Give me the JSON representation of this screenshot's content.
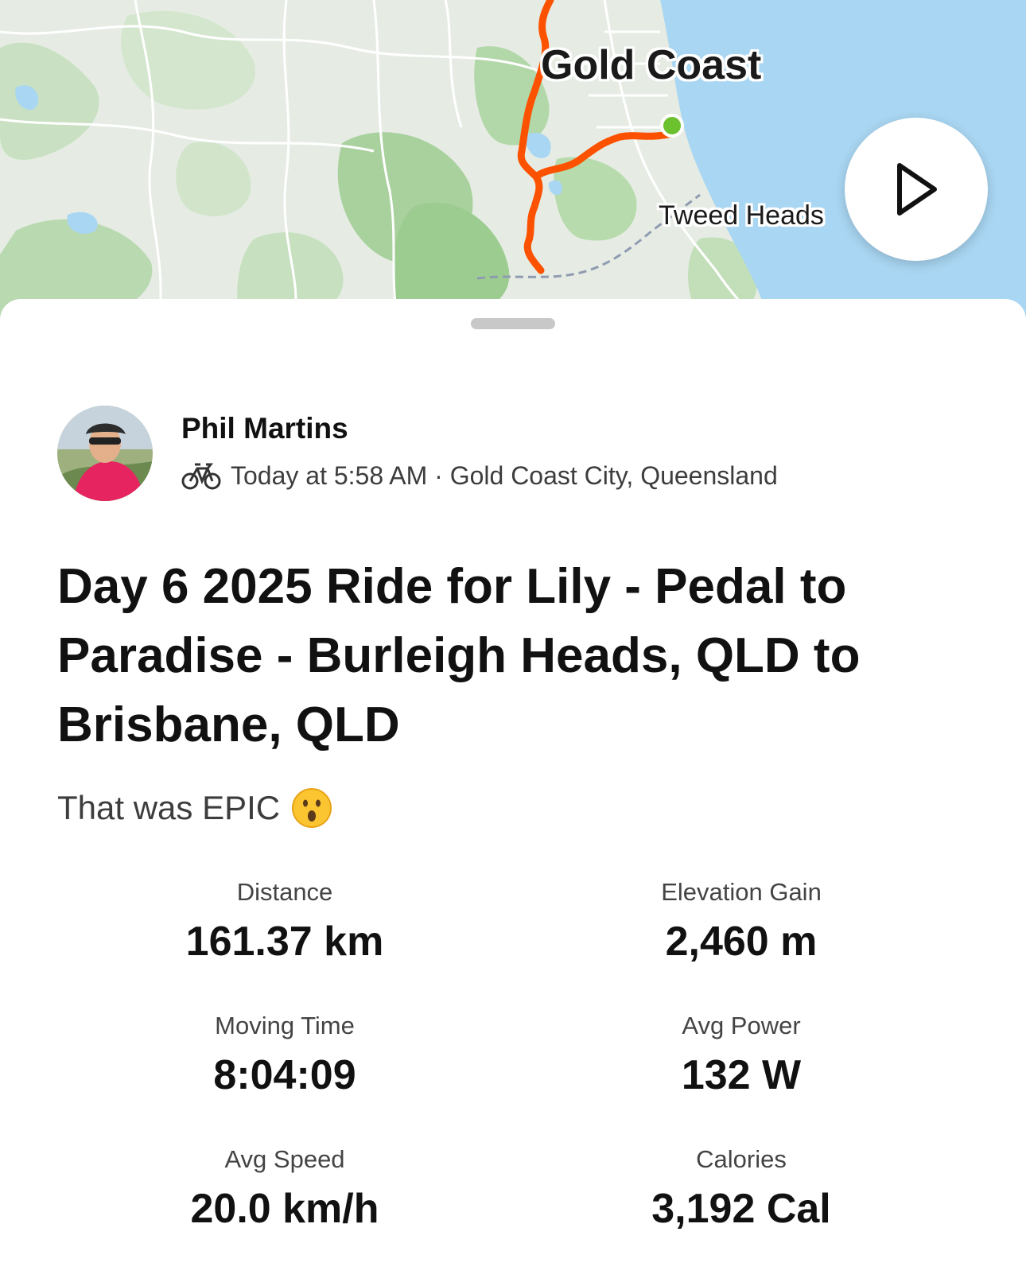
{
  "map": {
    "city_major": "Gold Coast",
    "city_minor": "Tweed Heads",
    "route_color": "#fc5200",
    "start_marker_color": "#6cc12e",
    "water_color": "#a9d6f2"
  },
  "map_controls": {
    "play_icon": "play-icon"
  },
  "athlete": {
    "name": "Phil Martins",
    "activity_icon": "bike-icon",
    "meta": "Today at 5:58 AM · Gold Coast City, Queensland"
  },
  "activity": {
    "title": "Day 6 2025 Ride for Lily - Pedal to Paradise - Burleigh Heads, QLD to Brisbane, QLD",
    "description": "That was EPIC",
    "description_emoji": "😮"
  },
  "stats": [
    {
      "label": "Distance",
      "value": "161.37 km"
    },
    {
      "label": "Elevation Gain",
      "value": "2,460 m"
    },
    {
      "label": "Moving Time",
      "value": "8:04:09"
    },
    {
      "label": "Avg Power",
      "value": "132 W"
    },
    {
      "label": "Avg Speed",
      "value": "20.0 km/h"
    },
    {
      "label": "Calories",
      "value": "3,192 Cal"
    }
  ]
}
